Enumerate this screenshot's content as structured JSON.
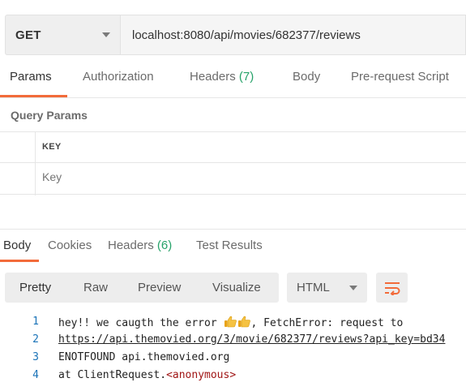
{
  "request": {
    "method": "GET",
    "url": "localhost:8080/api/movies/682377/reviews"
  },
  "request_tabs": {
    "params": "Params",
    "authorization": "Authorization",
    "headers": "Headers",
    "headers_count": "(7)",
    "body": "Body",
    "pre_request": "Pre-request Script"
  },
  "query_params": {
    "title": "Query Params",
    "key_header": "KEY",
    "key_placeholder": "Key"
  },
  "response_tabs": {
    "body": "Body",
    "cookies": "Cookies",
    "headers": "Headers",
    "headers_count": "(6)",
    "test_results": "Test Results"
  },
  "view_modes": {
    "pretty": "Pretty",
    "raw": "Raw",
    "preview": "Preview",
    "visualize": "Visualize"
  },
  "format": {
    "selected": "HTML"
  },
  "response_body": {
    "line1_no": "1",
    "line1_prefix": "hey!! we caugth the error ",
    "line1_suffix": ", FetchError: request to",
    "line2_no": "2",
    "line2_text": "https://api.themovied.org/3/movie/682377/reviews?api_key=bd34",
    "line3_no": "3",
    "line3_text": "ENOTFOUND api.themovied.org",
    "line4_no": "4",
    "line4_prefix": "at ClientRequest.",
    "line4_tag": "<anonymous>"
  },
  "colors": {
    "accent": "#f26b3a",
    "count_green": "#26a269",
    "line_number_blue": "#1a73b8"
  },
  "icons": {
    "method_caret": "chevron-down-icon",
    "format_caret": "chevron-down-icon",
    "wrap": "wrap-lines-icon",
    "emoji": "thumbs-up-emoji"
  }
}
